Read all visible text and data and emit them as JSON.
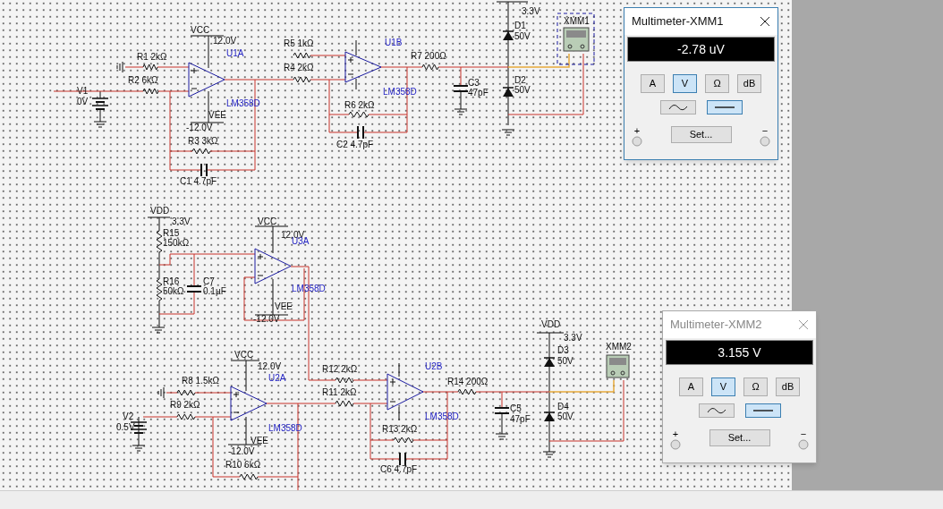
{
  "schematic": {
    "labels": [
      {
        "text": "VCC",
        "kind": "text"
      },
      {
        "text": "12.0V",
        "kind": "text"
      },
      {
        "text": "U1A",
        "kind": "ref"
      },
      {
        "text": "R1 2kΩ",
        "kind": "text"
      },
      {
        "text": "R2 6kΩ",
        "kind": "text"
      },
      {
        "text": "V1",
        "kind": "text"
      },
      {
        "text": "0V",
        "kind": "text"
      },
      {
        "text": "LM358D",
        "kind": "ref"
      },
      {
        "text": "VEE",
        "kind": "text"
      },
      {
        "text": "-12.0V",
        "kind": "text"
      },
      {
        "text": "R3 3kΩ",
        "kind": "text"
      },
      {
        "text": "C1 4.7pF",
        "kind": "text"
      },
      {
        "text": "R5 1kΩ",
        "kind": "text"
      },
      {
        "text": "R4 2kΩ",
        "kind": "text"
      },
      {
        "text": "U1B",
        "kind": "ref"
      },
      {
        "text": "LM358D",
        "kind": "ref"
      },
      {
        "text": "R6 2kΩ",
        "kind": "text"
      },
      {
        "text": "C2 4.7pF",
        "kind": "text"
      },
      {
        "text": "R7 200Ω",
        "kind": "text"
      },
      {
        "text": "C3",
        "kind": "text"
      },
      {
        "text": "47pF",
        "kind": "text"
      },
      {
        "text": "3.3V",
        "kind": "text"
      },
      {
        "text": "D1",
        "kind": "text"
      },
      {
        "text": "50V",
        "kind": "text"
      },
      {
        "text": "D2",
        "kind": "text"
      },
      {
        "text": "50V",
        "kind": "text"
      },
      {
        "text": "XMM1",
        "kind": "text"
      },
      {
        "text": "VDD",
        "kind": "text"
      },
      {
        "text": "3.3V",
        "kind": "text"
      },
      {
        "text": "R15",
        "kind": "text"
      },
      {
        "text": "150kΩ",
        "kind": "text"
      },
      {
        "text": "R16",
        "kind": "text"
      },
      {
        "text": "50kΩ",
        "kind": "text"
      },
      {
        "text": "C7",
        "kind": "text"
      },
      {
        "text": "0.1µF",
        "kind": "text"
      },
      {
        "text": "VCC",
        "kind": "text"
      },
      {
        "text": "12.0V",
        "kind": "text"
      },
      {
        "text": "U3A",
        "kind": "ref"
      },
      {
        "text": "LM358D",
        "kind": "ref"
      },
      {
        "text": "VEE",
        "kind": "text"
      },
      {
        "text": "-12.0V",
        "kind": "text"
      },
      {
        "text": "VCC",
        "kind": "text"
      },
      {
        "text": "12.0V",
        "kind": "text"
      },
      {
        "text": "R8 1.5kΩ",
        "kind": "text"
      },
      {
        "text": "U2A",
        "kind": "ref"
      },
      {
        "text": "R9 2kΩ",
        "kind": "text"
      },
      {
        "text": "V2",
        "kind": "text"
      },
      {
        "text": "0.5V",
        "kind": "text"
      },
      {
        "text": "LM358D",
        "kind": "ref"
      },
      {
        "text": "VEE",
        "kind": "text"
      },
      {
        "text": "-12.0V",
        "kind": "text"
      },
      {
        "text": "R10 6kΩ",
        "kind": "text"
      },
      {
        "text": "R12 2kΩ",
        "kind": "text"
      },
      {
        "text": "R11 2kΩ",
        "kind": "text"
      },
      {
        "text": "U2B",
        "kind": "ref"
      },
      {
        "text": "LM358D",
        "kind": "ref"
      },
      {
        "text": "R13 2kΩ",
        "kind": "text"
      },
      {
        "text": "C6 4.7pF",
        "kind": "text"
      },
      {
        "text": "R14 200Ω",
        "kind": "text"
      },
      {
        "text": "C5",
        "kind": "text"
      },
      {
        "text": "47pF",
        "kind": "text"
      },
      {
        "text": "VDD",
        "kind": "text"
      },
      {
        "text": "3.3V",
        "kind": "text"
      },
      {
        "text": "D3",
        "kind": "text"
      },
      {
        "text": "50V",
        "kind": "text"
      },
      {
        "text": "D4",
        "kind": "text"
      },
      {
        "text": "50V",
        "kind": "text"
      },
      {
        "text": "XMM2",
        "kind": "text"
      }
    ]
  },
  "multimeters": [
    {
      "title": "Multimeter-XMM1",
      "focused": true,
      "reading": "-2.78 uV",
      "modes": [
        {
          "label": "A",
          "selected": false
        },
        {
          "label": "V",
          "selected": true
        },
        {
          "label": "Ω",
          "selected": false
        },
        {
          "label": "dB",
          "selected": false
        }
      ],
      "signals": [
        {
          "kind": "ac",
          "selected": false
        },
        {
          "kind": "dc",
          "selected": true
        }
      ],
      "set_button": "Set...",
      "terminals": [
        "+",
        "−"
      ]
    },
    {
      "title": "Multimeter-XMM2",
      "focused": false,
      "reading": "3.155 V",
      "modes": [
        {
          "label": "A",
          "selected": false
        },
        {
          "label": "V",
          "selected": true
        },
        {
          "label": "Ω",
          "selected": false
        },
        {
          "label": "dB",
          "selected": false
        }
      ],
      "signals": [
        {
          "kind": "ac",
          "selected": false
        },
        {
          "kind": "dc",
          "selected": true
        }
      ],
      "set_button": "Set...",
      "terminals": [
        "+",
        "−"
      ]
    }
  ]
}
